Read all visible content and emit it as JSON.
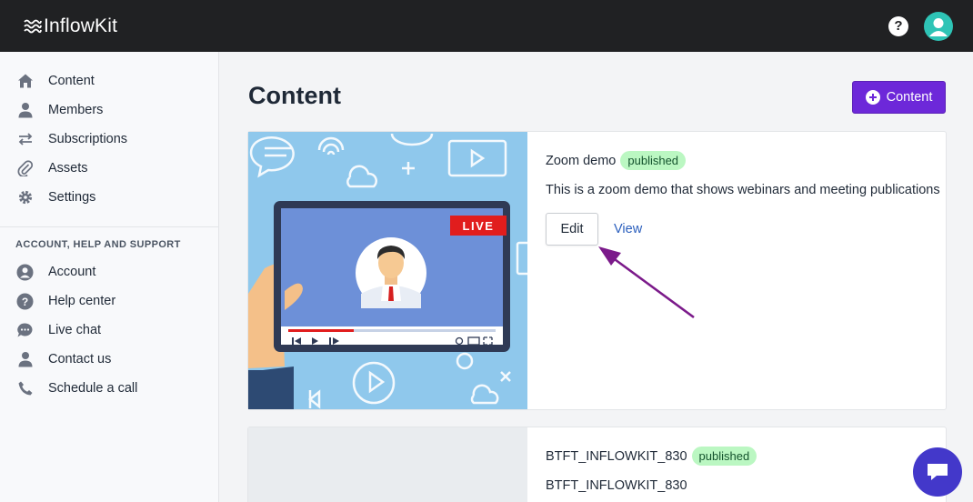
{
  "app": {
    "brand": "InflowKit"
  },
  "topbar": {
    "help_icon": "question-circle-icon",
    "avatar_icon": "user-avatar-icon"
  },
  "sidebar": {
    "items": [
      {
        "label": "Content",
        "icon": "home-icon"
      },
      {
        "label": "Members",
        "icon": "user-icon"
      },
      {
        "label": "Subscriptions",
        "icon": "arrows-exchange-icon"
      },
      {
        "label": "Assets",
        "icon": "paperclip-icon"
      },
      {
        "label": "Settings",
        "icon": "gear-icon"
      }
    ],
    "section_label": "ACCOUNT, HELP AND SUPPORT",
    "support_items": [
      {
        "label": "Account",
        "icon": "user-circle-icon"
      },
      {
        "label": "Help center",
        "icon": "question-circle-icon"
      },
      {
        "label": "Live chat",
        "icon": "chat-bubble-icon"
      },
      {
        "label": "Contact us",
        "icon": "user-icon"
      },
      {
        "label": "Schedule a call",
        "icon": "phone-icon"
      }
    ]
  },
  "main": {
    "title": "Content",
    "add_button_label": "Content",
    "cards": [
      {
        "title": "Zoom demo",
        "status": "published",
        "description": "This is a zoom demo that shows webinars and meeting publications",
        "edit_label": "Edit",
        "view_label": "View",
        "thumbnail_badge": "LIVE"
      },
      {
        "title": "BTFT_INFLOWKIT_830",
        "status": "published",
        "description": "BTFT_INFLOWKIT_830"
      }
    ]
  },
  "colors": {
    "topbar_bg": "#202123",
    "accent_purple": "#6d28d9",
    "badge_green": "#bbf7c2",
    "link_blue": "#2b5fbd",
    "avatar_teal": "#2ec4b6",
    "annotation_arrow": "#7b1a8a",
    "chat_fab": "#4338ca"
  }
}
